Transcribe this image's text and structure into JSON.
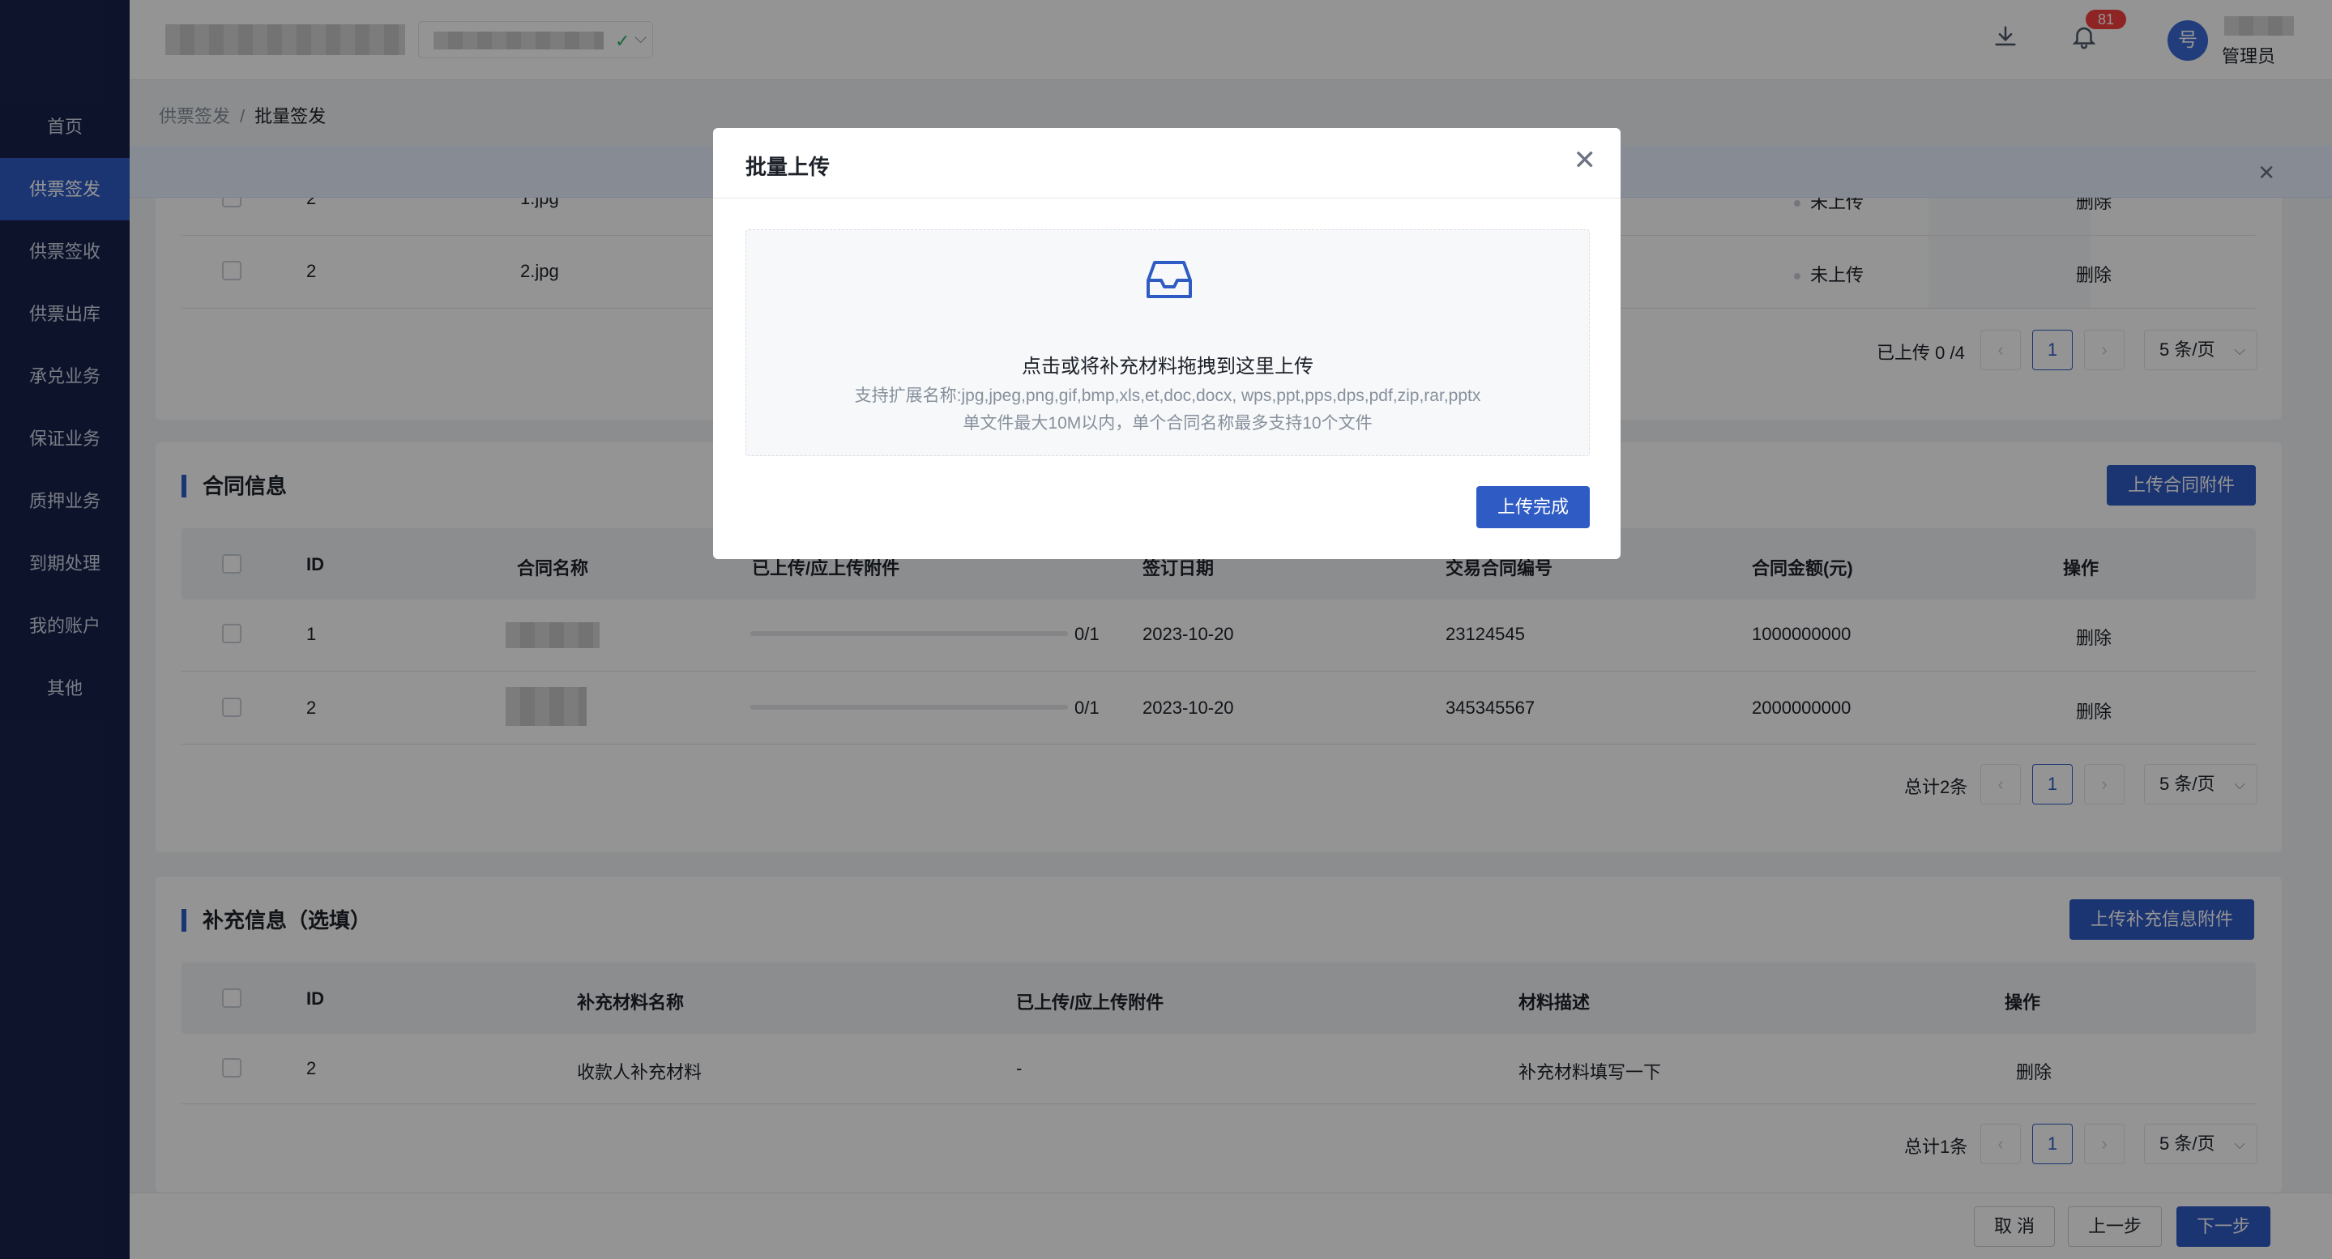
{
  "nav": {
    "items": [
      {
        "label": "首页"
      },
      {
        "label": "供票签发",
        "active": true
      },
      {
        "label": "供票签收"
      },
      {
        "label": "供票出库"
      },
      {
        "label": "承兑业务"
      },
      {
        "label": "保证业务"
      },
      {
        "label": "质押业务"
      },
      {
        "label": "到期处理"
      },
      {
        "label": "我的账户"
      },
      {
        "label": "其他"
      }
    ]
  },
  "header": {
    "notification_count": "81",
    "avatar_text": "号",
    "user_role": "管理员",
    "icons": {
      "download": "download-icon",
      "bell": "bell-icon"
    }
  },
  "breadcrumb": {
    "parent": "供票签发",
    "separator": "/",
    "current": "批量签发"
  },
  "files_table": {
    "rows": [
      {
        "id": "2",
        "name": "1.jpg",
        "status": "未上传",
        "action": "删除"
      },
      {
        "id": "2",
        "name": "2.jpg",
        "status": "未上传",
        "action": "删除"
      }
    ],
    "pager": {
      "summary": "已上传 0 /4",
      "page": "1",
      "size": "5 条/页"
    }
  },
  "contract": {
    "title": "合同信息",
    "upload_button": "上传合同附件",
    "columns": [
      "ID",
      "合同名称",
      "已上传/应上传附件",
      "签订日期",
      "交易合同编号",
      "合同金额(元)",
      "操作"
    ],
    "rows": [
      {
        "id": "1",
        "progress": "0/1",
        "date": "2023-10-20",
        "number": "23124545",
        "amount": "1000000000",
        "action": "删除"
      },
      {
        "id": "2",
        "progress": "0/1",
        "date": "2023-10-20",
        "number": "345345567",
        "amount": "2000000000",
        "action": "删除"
      }
    ],
    "pager": {
      "summary": "总计2条",
      "page": "1",
      "size": "5 条/页"
    }
  },
  "supplement": {
    "title": "补充信息（选填）",
    "upload_button": "上传补充信息附件",
    "columns": [
      "ID",
      "补充材料名称",
      "已上传/应上传附件",
      "材料描述",
      "操作"
    ],
    "rows": [
      {
        "id": "2",
        "name": "收款人补充材料",
        "progress": "-",
        "desc": "补充材料填写一下",
        "action": "删除"
      }
    ],
    "pager": {
      "summary": "总计1条",
      "page": "1",
      "size": "5 条/页"
    }
  },
  "footer": {
    "cancel": "取 消",
    "prev": "上一步",
    "next": "下一步"
  },
  "modal": {
    "title": "批量上传",
    "drop_main": "点击或将补充材料拖拽到这里上传",
    "drop_sub1": "支持扩展名称:jpg,jpeg,png,gif,bmp,xls,et,doc,docx, wps,ppt,pps,dps,pdf,zip,rar,pptx",
    "drop_sub2": "单文件最大10M以内，单个合同名称最多支持10个文件",
    "confirm": "上传完成"
  },
  "colors": {
    "primary": "#2f5bc4",
    "sidebar": "#17224a",
    "badge": "#f53f3f",
    "success": "#2db55d"
  }
}
